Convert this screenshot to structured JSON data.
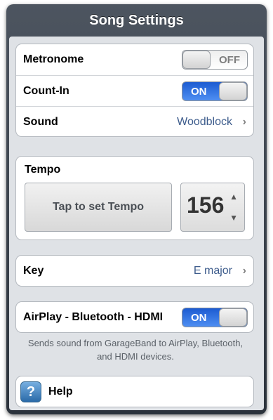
{
  "title": "Song Settings",
  "metronome": {
    "label": "Metronome",
    "state": "OFF"
  },
  "count_in": {
    "label": "Count-In",
    "state": "ON"
  },
  "sound": {
    "label": "Sound",
    "value": "Woodblock"
  },
  "tempo": {
    "label": "Tempo",
    "tap_label": "Tap to set Tempo",
    "value": "156"
  },
  "key": {
    "label": "Key",
    "value": "E major"
  },
  "airplay": {
    "label": "AirPlay - Bluetooth - HDMI",
    "state": "ON"
  },
  "note": "Sends sound from GarageBand to AirPlay, Bluetooth, and HDMI devices.",
  "help": {
    "label": "Help",
    "icon": "?"
  },
  "colors": {
    "switch_on": "#2f71e3",
    "value_text": "#3d5c8c",
    "header": "#3a414b"
  }
}
